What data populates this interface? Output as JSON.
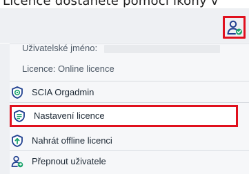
{
  "header": {
    "instruction_text": "Licence dostanete pomocí ikony v"
  },
  "account_button": {
    "icon": "user-settings-icon"
  },
  "menu": {
    "username_label": "Uživatelské jméno:",
    "licence_label": "Licence: Online licence",
    "items": [
      {
        "label": "SCIA Orgadmin",
        "icon": "shield-account-icon"
      },
      {
        "label": "Nastavení licence",
        "icon": "shield-settings-icon"
      },
      {
        "label": "Nahrát offline licenci",
        "icon": "shield-upload-icon"
      },
      {
        "label": "Přepnout uživatele",
        "icon": "switch-user-icon"
      }
    ]
  },
  "colors": {
    "highlight": "#e0101d",
    "icon_blue": "#1f3f8f",
    "accent_green": "#1aa36b"
  }
}
